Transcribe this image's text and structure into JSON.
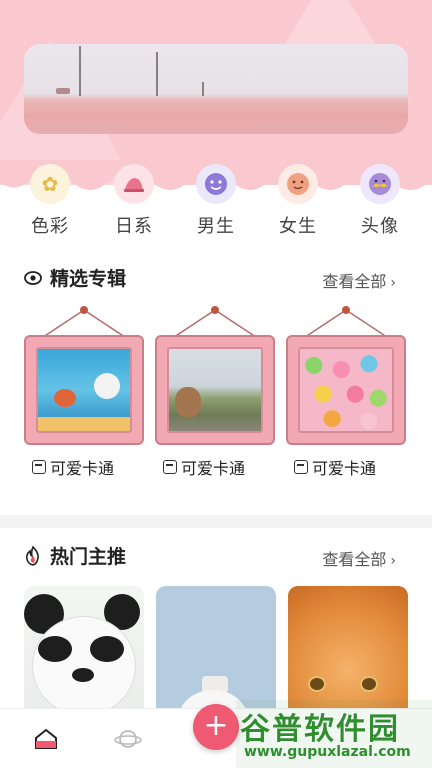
{
  "categories": [
    {
      "label": "色彩",
      "icon": "flower-icon",
      "glyph": "✿",
      "color": "#e7b84a"
    },
    {
      "label": "日系",
      "icon": "hat-icon",
      "glyph": "⛑",
      "color": "#e9758c"
    },
    {
      "label": "男生",
      "icon": "face-icon",
      "glyph": "☻",
      "color": "#8b7ad8"
    },
    {
      "label": "女生",
      "icon": "smile-icon",
      "glyph": "☺",
      "color": "#e98b6c"
    },
    {
      "label": "头像",
      "icon": "mustache-face-icon",
      "glyph": "☺",
      "color": "#e7b84a"
    }
  ],
  "featured": {
    "title": "精选专辑",
    "more": "查看全部",
    "items": [
      {
        "label": "可爱卡通"
      },
      {
        "label": "可爱卡通"
      },
      {
        "label": "可爱卡通"
      }
    ]
  },
  "hot": {
    "title": "热门主推",
    "more": "查看全部"
  },
  "nav": {
    "add": "+"
  },
  "watermark": {
    "title": "谷普软件园",
    "url": "www.gupuxlazal.com"
  },
  "colors": {
    "header_pink": "#f9c9cf",
    "accent": "#ef5a72"
  }
}
